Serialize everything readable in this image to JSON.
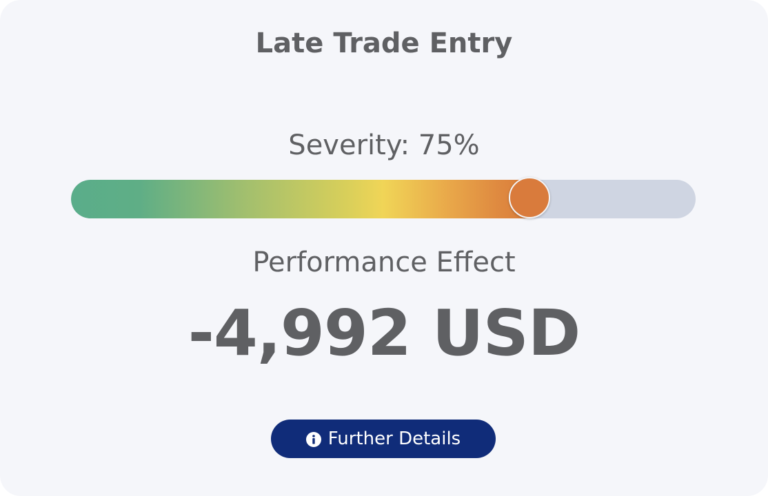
{
  "card": {
    "title": "Late Trade Entry",
    "severity": {
      "label": "Severity: 75%",
      "value_percent": 75
    },
    "performance": {
      "label": "Performance Effect",
      "value": "-4,992 USD"
    },
    "details_button": {
      "label": "Further Details",
      "icon": "info-icon"
    }
  },
  "colors": {
    "card_background": "#f5f6fa",
    "text": "#5f6063",
    "track": "#cfd5e2",
    "knob": "#d97b3c",
    "button": "#102c79",
    "gradient_start": "#5aad8a",
    "gradient_mid": "#f0d557",
    "gradient_end": "#d97c3b"
  }
}
